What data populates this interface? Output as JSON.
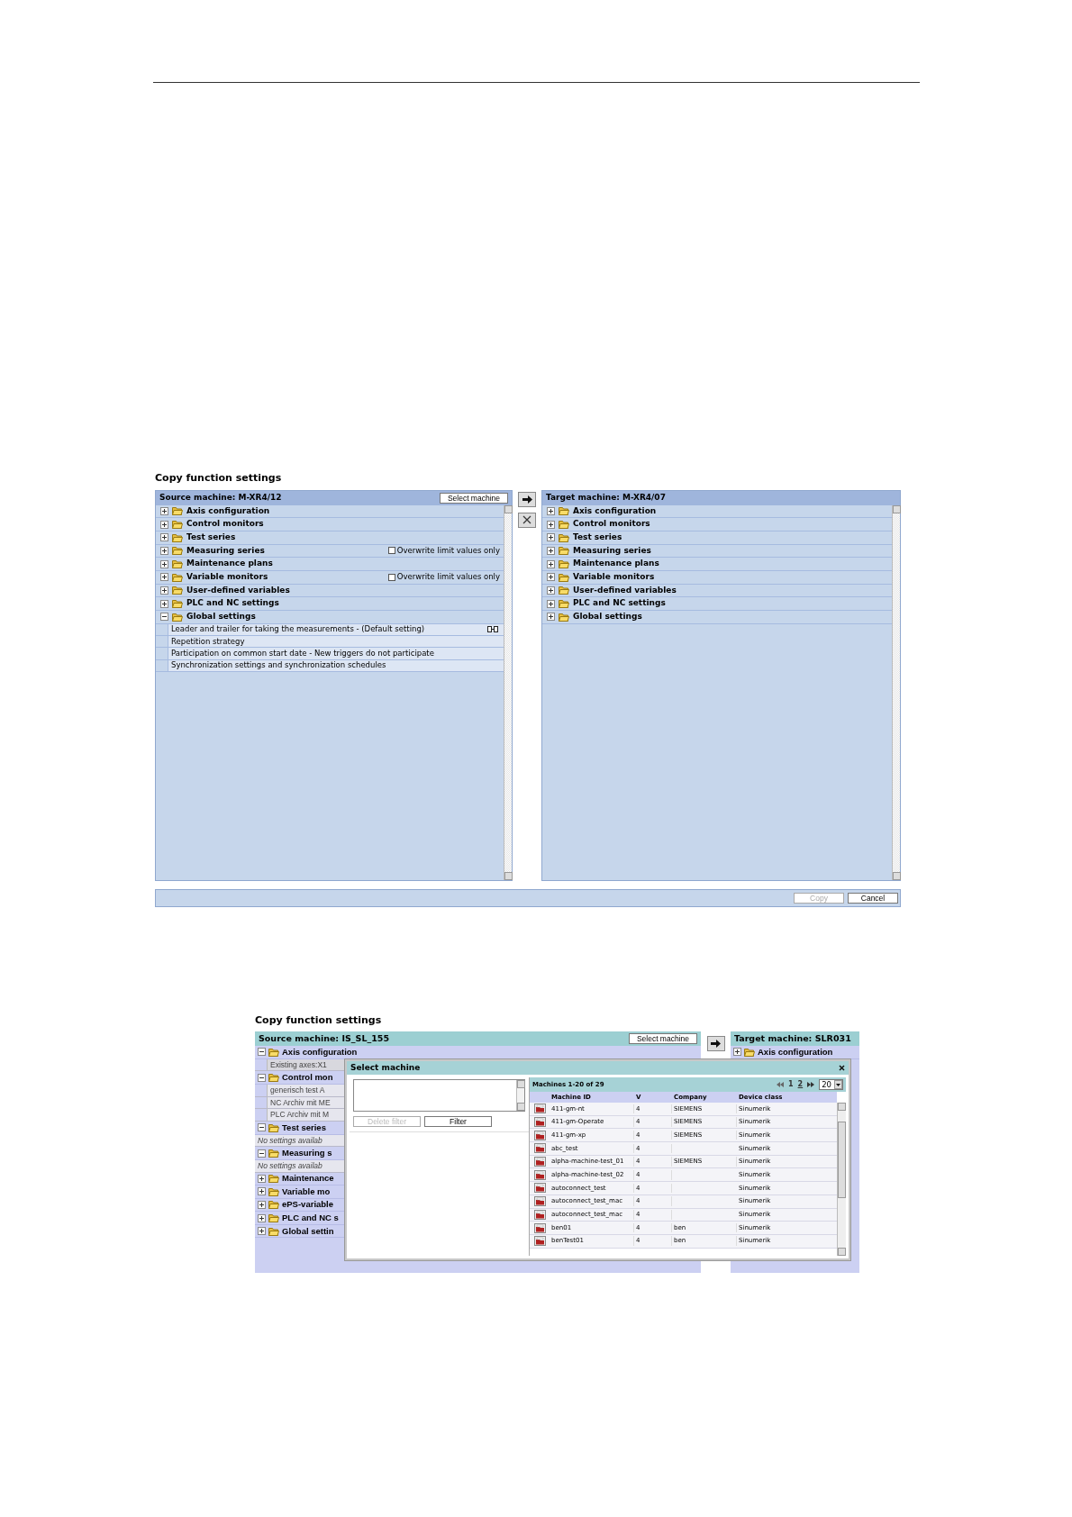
{
  "figure_1": {
    "title": "Copy function settings",
    "source": {
      "header": "Source machine: M-XR4/12",
      "select_button": "Select machine",
      "items": [
        {
          "label": "Axis configuration",
          "expanded": false
        },
        {
          "label": "Control monitors",
          "expanded": false
        },
        {
          "label": "Test series",
          "expanded": false
        },
        {
          "label": "Measuring series",
          "expanded": false,
          "option": {
            "label": "Overwrite limit values only",
            "checked": false
          }
        },
        {
          "label": "Maintenance plans",
          "expanded": false
        },
        {
          "label": "Variable monitors",
          "expanded": false,
          "option": {
            "label": "Overwrite limit values only",
            "checked": false
          }
        },
        {
          "label": "User-defined variables",
          "expanded": false
        },
        {
          "label": "PLC and NC settings",
          "expanded": false
        },
        {
          "label": "Global settings",
          "expanded": true,
          "children": [
            {
              "label": "Leader and trailer for taking the measurements - (Default setting)",
              "linked": true
            },
            {
              "label": "Repetition strategy",
              "linked": false
            },
            {
              "label": "Participation on common start date - New triggers do not participate",
              "linked": false
            },
            {
              "label": "Synchronization settings and synchronization schedules",
              "linked": false
            }
          ]
        }
      ]
    },
    "target": {
      "header": "Target machine: M-XR4/07",
      "items": [
        {
          "label": "Axis configuration",
          "expanded": false
        },
        {
          "label": "Control monitors",
          "expanded": false
        },
        {
          "label": "Test series",
          "expanded": false
        },
        {
          "label": "Measuring series",
          "expanded": false
        },
        {
          "label": "Maintenance plans",
          "expanded": false
        },
        {
          "label": "Variable monitors",
          "expanded": false
        },
        {
          "label": "User-defined variables",
          "expanded": false
        },
        {
          "label": "PLC and NC settings",
          "expanded": false
        },
        {
          "label": "Global settings",
          "expanded": false
        }
      ]
    },
    "buttons": [
      {
        "label": "Copy",
        "disabled": true
      },
      {
        "label": "Cancel",
        "disabled": false
      }
    ]
  },
  "figure_2": {
    "title": "Copy function settings",
    "source": {
      "header": "Source machine: IS_SL_155",
      "select_button": "Select machine",
      "items": [
        {
          "label": "Axis configuration",
          "expanded": true,
          "children": [
            {
              "label": "Existing axes:X1",
              "kind": "setting"
            }
          ]
        },
        {
          "label": "Control mon",
          "expanded": true,
          "children": [
            {
              "label": "generisch test A",
              "kind": "setting"
            },
            {
              "label": "NC Archiv mit ME",
              "kind": "setting"
            },
            {
              "label": "PLC Archiv mit M",
              "kind": "setting"
            }
          ]
        },
        {
          "label": "Test series",
          "expanded": true,
          "children": [
            {
              "label": "No settings availab",
              "kind": "empty"
            }
          ]
        },
        {
          "label": "Measuring s",
          "expanded": true,
          "children": [
            {
              "label": "No settings availab",
              "kind": "empty"
            }
          ]
        },
        {
          "label": "Maintenance",
          "expanded": false
        },
        {
          "label": "Variable mo",
          "expanded": false
        },
        {
          "label": "ePS-variable",
          "expanded": false
        },
        {
          "label": "PLC and NC s",
          "expanded": false
        },
        {
          "label": "Global settin",
          "expanded": false
        }
      ]
    },
    "target": {
      "header": "Target machine: SLR031",
      "items": [
        {
          "label": "Axis configuration",
          "expanded": false
        }
      ]
    },
    "dialog": {
      "title": "Select machine",
      "filter_buttons": [
        {
          "label": "Delete filter",
          "disabled": true
        },
        {
          "label": "Filter",
          "disabled": false
        }
      ],
      "summary": "Machines 1-20 of 29",
      "pages": [
        {
          "label": "1",
          "selected": true
        },
        {
          "label": "2",
          "selected": false
        }
      ],
      "page_size": "20",
      "columns": [
        "Machine ID",
        "V",
        "Company",
        "Device class"
      ],
      "rows": [
        {
          "id": "411-gm-nt",
          "v": "4",
          "company": "SIEMENS",
          "device_class": "Sinumerik"
        },
        {
          "id": "411-gm-Operate",
          "v": "4",
          "company": "SIEMENS",
          "device_class": "Sinumerik"
        },
        {
          "id": "411-gm-xp",
          "v": "4",
          "company": "SIEMENS",
          "device_class": "Sinumerik"
        },
        {
          "id": "abc_test",
          "v": "4",
          "device_class": "Sinumerik"
        },
        {
          "id": "alpha-machine-test_01",
          "v": "4",
          "company": "SIEMENS",
          "device_class": "Sinumerik"
        },
        {
          "id": "alpha-machine-test_02",
          "v": "4",
          "device_class": "Sinumerik"
        },
        {
          "id": "autoconnect_test",
          "v": "4",
          "device_class": "Sinumerik"
        },
        {
          "id": "autoconnect_test_mac",
          "v": "4",
          "device_class": "Sinumerik"
        },
        {
          "id": "autoconnect_test_mac",
          "v": "4",
          "device_class": "Sinumerik"
        },
        {
          "id": "ben01",
          "v": "4",
          "company": "ben",
          "device_class": "Sinumerik"
        },
        {
          "id": "benTest01",
          "v": "4",
          "company": "ben",
          "device_class": "Sinumerik"
        }
      ]
    }
  }
}
